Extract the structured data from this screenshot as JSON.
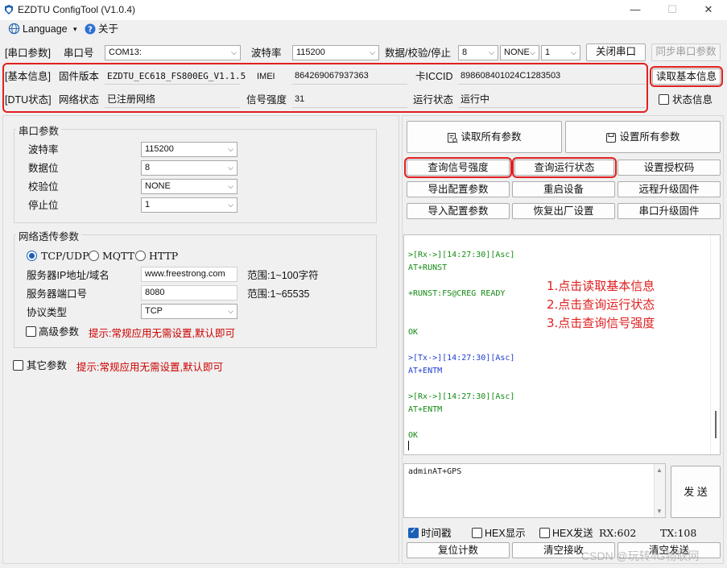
{
  "app": {
    "title": "EZDTU ConfigTool (V1.0.4)",
    "window_controls": {
      "minimize": "—",
      "maximize": "☐",
      "close": "✕"
    }
  },
  "menu": {
    "language": "Language",
    "language_caret": "▾",
    "about": "关于"
  },
  "serial_bar": {
    "section": "[串口参数]",
    "port_label": "串口号",
    "port_value": "COM13:",
    "baud_label": "波特率",
    "baud_value": "115200",
    "frame_label": "数据/校验/停止",
    "databits": "8",
    "parity": "NONE",
    "stopbits": "1",
    "close_port": "关闭串口",
    "sync_port": "同步串口参数"
  },
  "basic_info": {
    "section": "[基本信息]",
    "firmware_label": "固件版本",
    "firmware_value": "EZDTU_EC618_FS800EG_V1.1.5",
    "imei_label": "IMEI",
    "imei_value": "864269067937363",
    "iccid_label": "卡ICCID",
    "iccid_value": "898608401024C1283503",
    "read_button": "读取基本信息"
  },
  "dtu_status": {
    "section": "[DTU状态]",
    "net_label": "网络状态",
    "net_value": "已注册网络",
    "signal_label": "信号强度",
    "signal_value": "31",
    "run_label": "运行状态",
    "run_value": "运行中",
    "status_check": "状态信息"
  },
  "serial_params": {
    "title": "串口参数",
    "rows": [
      {
        "label": "波特率",
        "value": "115200"
      },
      {
        "label": "数据位",
        "value": "8"
      },
      {
        "label": "校验位",
        "value": "NONE"
      },
      {
        "label": "停止位",
        "value": "1"
      }
    ]
  },
  "network": {
    "title": "网络透传参数",
    "protocols": [
      "TCP/UDP",
      "MQTT",
      "HTTP"
    ],
    "selected_protocol": "TCP/UDP",
    "server_label": "服务器IP地址/域名",
    "server_value": "www.freestrong.com",
    "server_range": "范围:1~100字符",
    "port_label": "服务器端口号",
    "port_value": "8080",
    "port_range": "范围:1~65535",
    "proto_label": "协议类型",
    "proto_value": "TCP",
    "advanced_label": "高级参数",
    "advanced_hint": "提示:常规应用无需设置,默认即可"
  },
  "other": {
    "label": "其它参数",
    "hint": "提示:常规应用无需设置,默认即可"
  },
  "actions": {
    "read_all": "读取所有参数",
    "set_all": "设置所有参数",
    "query_signal": "查询信号强度",
    "query_status": "查询运行状态",
    "set_auth": "设置授权码",
    "export_config": "导出配置参数",
    "restart": "重启设备",
    "remote_upgrade": "远程升级固件",
    "import_config": "导入配置参数",
    "factory_reset": "恢复出厂设置",
    "serial_upgrade": "串口升级固件"
  },
  "log": {
    "lines": [
      {
        "text": ">[Rx->][14:27:30][Asc]",
        "kind": "green"
      },
      {
        "text": "AT+RUNST",
        "kind": "green"
      },
      {
        "text": "",
        "kind": "empty"
      },
      {
        "text": "+RUNST:FS@CREG READY",
        "kind": "green"
      },
      {
        "text": "",
        "kind": "empty"
      },
      {
        "text": "",
        "kind": "empty"
      },
      {
        "text": "OK",
        "kind": "green"
      },
      {
        "text": "",
        "kind": "empty"
      },
      {
        "text": ">[Tx->][14:27:30][Asc]",
        "kind": "blue"
      },
      {
        "text": "AT+ENTM",
        "kind": "blue"
      },
      {
        "text": "",
        "kind": "empty"
      },
      {
        "text": ">[Rx->][14:27:30][Asc]",
        "kind": "green"
      },
      {
        "text": "AT+ENTM",
        "kind": "green"
      },
      {
        "text": "",
        "kind": "empty"
      },
      {
        "text": "OK",
        "kind": "green"
      }
    ],
    "steps": [
      "1.点击读取基本信息",
      "2.点击查询运行状态",
      "3.点击查询信号强度"
    ]
  },
  "send": {
    "text": "adminAT+GPS",
    "send_button": "发 送",
    "timestamp": "时间戳",
    "hex_show": "HEX显示",
    "hex_send": "HEX发送",
    "rx_label": "RX:602",
    "tx_label": "TX:108",
    "reset_count": "复位计数",
    "clear_recv": "清空接收",
    "clear_send": "清空发送"
  },
  "watermark": "CSDN @玩转4G物联网",
  "colors": {
    "highlight": "#e02020",
    "accent": "#1a5fb4",
    "log_green": "#138a13",
    "log_blue": "#1f3fcf"
  }
}
